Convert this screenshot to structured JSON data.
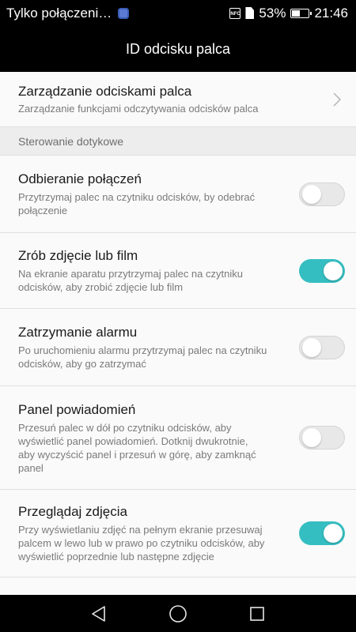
{
  "status_bar": {
    "carrier": "Tylko połączeni…",
    "battery": "53%",
    "battery_level": 0.53,
    "time": "21:46",
    "icons": [
      "app-badge-icon",
      "nfc-icon",
      "sim-icon",
      "battery-icon"
    ]
  },
  "app_bar": {
    "title": "ID odcisku palca"
  },
  "manage": {
    "title": "Zarządzanie odciskami palca",
    "subtitle": "Zarządzanie funkcjami odczytywania odcisków palca",
    "icon": "chevron-right-icon"
  },
  "section": {
    "label": "Sterowanie dotykowe"
  },
  "settings": [
    {
      "title": "Odbieranie połączeń",
      "subtitle_lines": [
        "Przytrzymaj palec na czytniku odcisków, by odebrać",
        "połączenie"
      ],
      "enabled": false
    },
    {
      "title": "Zrób zdjęcie lub film",
      "subtitle_lines": [
        "Na ekranie aparatu przytrzymaj palec na czytniku",
        "odcisków, aby zrobić zdjęcie lub film"
      ],
      "enabled": true
    },
    {
      "title": "Zatrzymanie alarmu",
      "subtitle_lines": [
        "Po uruchomieniu alarmu przytrzymaj palec na czytniku",
        "odcisków, aby go zatrzymać"
      ],
      "enabled": false
    },
    {
      "title": "Panel powiadomień",
      "subtitle_lines": [
        "Przesuń palec w dół po czytniku odcisków, aby",
        "wyświetlić panel powiadomień. Dotknij dwukrotnie,",
        "aby wyczyścić panel i przesuń w górę, aby zamknąć",
        "panel"
      ],
      "enabled": false
    },
    {
      "title": "Przeglądaj zdjęcia",
      "subtitle_lines": [
        "Przy wyświetlaniu zdjęć na pełnym ekranie przesuwaj",
        "palcem w lewo lub w prawo po czytniku odcisków, aby",
        "wyświetlić poprzednie lub następne zdjęcie"
      ],
      "enabled": true
    }
  ],
  "colors": {
    "toggle_on": "#35bec1",
    "toggle_off": "#e8e8e8"
  },
  "nav_bar": {
    "icons": [
      "back-triangle-icon",
      "home-circle-icon",
      "recents-square-icon"
    ]
  }
}
